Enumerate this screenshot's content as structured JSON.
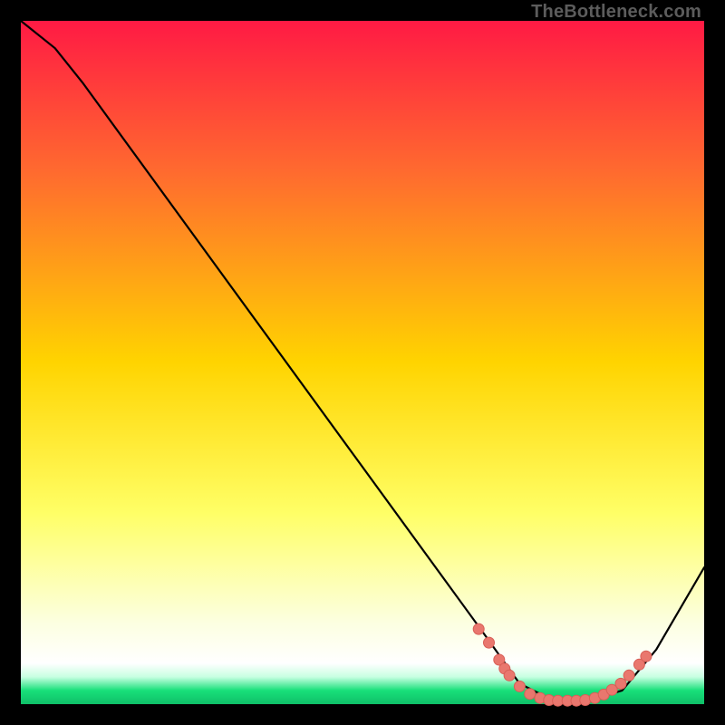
{
  "watermark": "TheBottleneck.com",
  "colors": {
    "black": "#000000",
    "curve": "#000000",
    "marker_fill": "#e9776e",
    "marker_stroke": "#d85f57",
    "grad_top": "#ff1a44",
    "grad_mid_upper": "#ff7a2a",
    "grad_mid": "#ffd400",
    "grad_mid_lower": "#ffff66",
    "grad_pale": "#fcffe0",
    "grad_white": "#ffffff",
    "grad_green": "#18e07a"
  },
  "chart_data": {
    "type": "line",
    "title": "",
    "xlabel": "",
    "ylabel": "",
    "xlim": [
      0,
      100
    ],
    "ylim": [
      0,
      100
    ],
    "curve": [
      {
        "x": 0,
        "y": 100
      },
      {
        "x": 5,
        "y": 96
      },
      {
        "x": 9,
        "y": 91
      },
      {
        "x": 68,
        "y": 10
      },
      {
        "x": 73,
        "y": 3
      },
      {
        "x": 78,
        "y": 0.5
      },
      {
        "x": 83,
        "y": 0.5
      },
      {
        "x": 88,
        "y": 2
      },
      {
        "x": 93,
        "y": 8
      },
      {
        "x": 100,
        "y": 20
      }
    ],
    "markers": [
      {
        "x": 67,
        "y": 11
      },
      {
        "x": 68.5,
        "y": 9
      },
      {
        "x": 70,
        "y": 6.5
      },
      {
        "x": 70.8,
        "y": 5.2
      },
      {
        "x": 71.5,
        "y": 4.2
      },
      {
        "x": 73,
        "y": 2.6
      },
      {
        "x": 74.5,
        "y": 1.5
      },
      {
        "x": 76,
        "y": 0.9
      },
      {
        "x": 77.3,
        "y": 0.6
      },
      {
        "x": 78.6,
        "y": 0.5
      },
      {
        "x": 80,
        "y": 0.5
      },
      {
        "x": 81.3,
        "y": 0.5
      },
      {
        "x": 82.6,
        "y": 0.6
      },
      {
        "x": 84,
        "y": 0.9
      },
      {
        "x": 85.3,
        "y": 1.4
      },
      {
        "x": 86.5,
        "y": 2.1
      },
      {
        "x": 87.8,
        "y": 3
      },
      {
        "x": 89,
        "y": 4.2
      },
      {
        "x": 90.5,
        "y": 5.8
      },
      {
        "x": 91.5,
        "y": 7
      }
    ]
  }
}
